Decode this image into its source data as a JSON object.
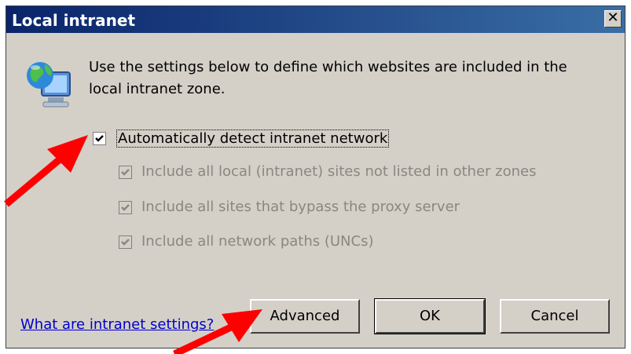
{
  "dialog": {
    "title": "Local intranet",
    "close_label": "✕"
  },
  "intro_text": "Use the settings below to define which websites are included in the local intranet zone.",
  "options": [
    {
      "label": "Automatically detect intranet network",
      "checked": true,
      "enabled": true
    },
    {
      "label": "Include all local (intranet) sites not listed in other zones",
      "checked": true,
      "enabled": false
    },
    {
      "label": "Include all sites that bypass the proxy server",
      "checked": true,
      "enabled": false
    },
    {
      "label": "Include all network paths (UNCs)",
      "checked": true,
      "enabled": false
    }
  ],
  "help_link": "What are intranet settings?",
  "buttons": {
    "advanced": "Advanced",
    "ok": "OK",
    "cancel": "Cancel"
  },
  "colors": {
    "dialog_bg": "#d4d0c8",
    "title_bar": "#0a246a",
    "link": "#0000cc",
    "annotation_arrow": "#ff0000"
  }
}
